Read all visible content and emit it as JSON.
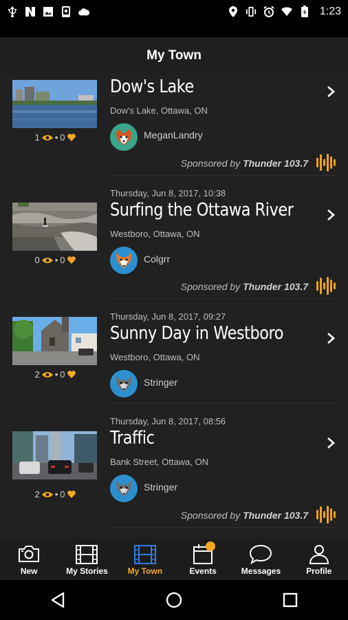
{
  "status_bar": {
    "time": "1:23",
    "left_icons": [
      "usb-icon",
      "nfc-n-icon",
      "image-icon",
      "phone-notification-icon",
      "cloud-icon"
    ],
    "right_icons": [
      "location-icon",
      "vibrate-icon",
      "alarm-icon",
      "wifi-icon",
      "battery-icon"
    ]
  },
  "app_bar": {
    "title": "My Town"
  },
  "stories": [
    {
      "date": "",
      "title": "Dow's Lake",
      "location": "Dow's Lake, Ottawa, ON",
      "views": "1",
      "likes": "0",
      "username": "MeganLandry",
      "avatar": "red-panda-avatar",
      "sponsored": true,
      "sponsor_prefix": "Sponsored by",
      "sponsor_name": "Thunder 103.7"
    },
    {
      "date": "Thursday, Jun 8, 2017, 10:38",
      "title": "Surfing the Ottawa River",
      "location": "Westboro, Ottawa, ON",
      "views": "0",
      "likes": "0",
      "username": "Colgrr",
      "avatar": "fox-avatar",
      "sponsored": true,
      "sponsor_prefix": "Sponsored by",
      "sponsor_name": "Thunder 103.7"
    },
    {
      "date": "Thursday, Jun 8, 2017, 09:27",
      "title": "Sunny Day in Westboro",
      "location": "Westboro, Ottawa, ON",
      "views": "2",
      "likes": "0",
      "username": "Stringer",
      "avatar": "wolf-avatar",
      "sponsored": false
    },
    {
      "date": "Thursday, Jun 8, 2017, 08:56",
      "title": "Traffic",
      "location": "Bank Street, Ottawa, ON",
      "views": "2",
      "likes": "0",
      "username": "Stringer",
      "avatar": "wolf-avatar",
      "sponsored": true,
      "sponsor_prefix": "Sponsored by",
      "sponsor_name": "Thunder 103.7"
    }
  ],
  "stats_separator": "•",
  "bottom_nav": {
    "items": [
      {
        "label": "New",
        "icon": "camera-icon",
        "active": false
      },
      {
        "label": "My Stories",
        "icon": "film-strip-icon",
        "active": false
      },
      {
        "label": "My Town",
        "icon": "film-strip-icon",
        "active": true
      },
      {
        "label": "Events",
        "icon": "calendar-icon",
        "active": false,
        "badge": true
      },
      {
        "label": "Messages",
        "icon": "chat-bubble-icon",
        "active": false
      },
      {
        "label": "Profile",
        "icon": "person-icon",
        "active": false
      }
    ]
  },
  "system_nav": [
    "back-icon",
    "home-icon",
    "recents-icon"
  ],
  "colors": {
    "accent": "#f5a623",
    "active_blue": "#2f7de1",
    "background": "#212121",
    "appbar": "#1f1f1f"
  }
}
